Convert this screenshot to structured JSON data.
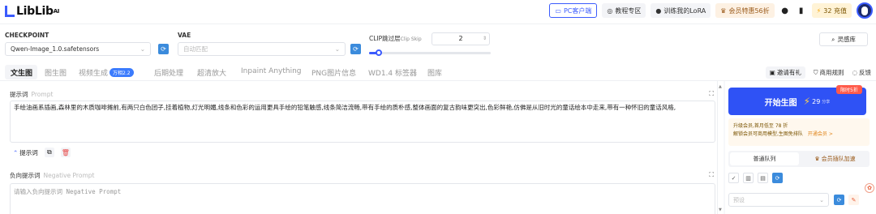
{
  "app": {
    "logo": "LibLib",
    "logo_suffix": "AI"
  },
  "topbar": {
    "pc_client": "PC客户端",
    "tutorial": "教程专区",
    "train_lora": "训练我的LoRA",
    "vip": "会员特惠56折",
    "credits": "32 充值"
  },
  "settings": {
    "checkpoint_label": "CHECKPOINT",
    "checkpoint_value": "Qwen-Image_1.0.safetensors",
    "vae_label": "VAE",
    "vae_placeholder": "自动匹配",
    "clip_label": "CLIP跳过层",
    "clip_label_en": "Clip Skip",
    "clip_value": "2",
    "clip_fraction": 0.08,
    "inspiration": "灵感库"
  },
  "tabs": {
    "items": [
      "文生图",
      "图生图",
      "视频生成",
      "后期处理",
      "超清放大",
      "Inpaint Anything",
      "PNG图片信息",
      "WD1.4 标签器",
      "图库"
    ],
    "video_badge": "万相2.2",
    "invite": "邀请有礼",
    "rules": "商用规则",
    "feedback": "反馈"
  },
  "prompt": {
    "title": "提示词",
    "title_en": "Prompt",
    "text": "手绘油画系插画,森林里的木质咖啡摊前,有两只白色团子,挂着植物,灯光明媚,线条和色彩的运用更具手绘的铅笔触感,线条简洁流畅,带有手绘的质朴感,整体画面的复古韵味更突出,色彩鲜艳,仿佛是从旧时光的童话绘本中走来,带有一种怀旧的童话风格,",
    "toggle": "提示词"
  },
  "negative": {
    "title": "负向提示词",
    "title_en": "Negative Prompt",
    "placeholder": "请输入负向提示词 Negative Prompt"
  },
  "side": {
    "generate": "开始生图",
    "cost": "29",
    "cost_unit": "分享",
    "limited": "限时5折",
    "promo_line1": "升级会员,首月低至 78 折",
    "promo_line2": "解锁会员可商用模型,生图免排队",
    "promo_link": "开通会员 >",
    "queue_normal": "普通队列",
    "queue_vip": "会员插队加速",
    "preset_placeholder": "预设"
  },
  "colors": {
    "accent": "#2f52f5",
    "limited": "#ff5a4a"
  }
}
